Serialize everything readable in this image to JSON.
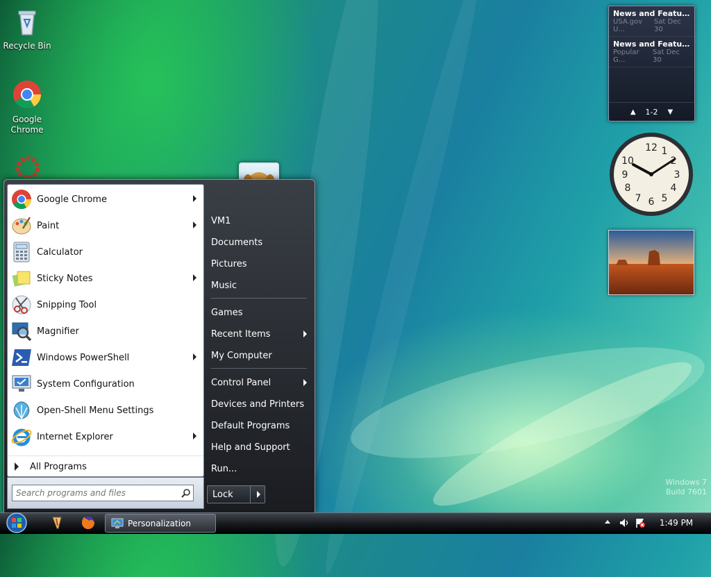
{
  "desktop": {
    "icons": [
      {
        "label": "Recycle Bin"
      },
      {
        "label": "Google Chrome"
      }
    ],
    "watermark": {
      "line1": "Windows 7",
      "line2": "Build 7601"
    }
  },
  "gadgets": {
    "news": {
      "items": [
        {
          "title": "News and Features f...",
          "source": "USA.gov U...",
          "date": "Sat Dec 30"
        },
        {
          "title": "News and Feature...",
          "source": "Popular G...",
          "date": "Sat Dec 30"
        }
      ],
      "page": "1-2"
    }
  },
  "start_menu": {
    "programs": [
      {
        "label": "Google Chrome",
        "has_submenu": true
      },
      {
        "label": "Paint",
        "has_submenu": true
      },
      {
        "label": "Calculator",
        "has_submenu": false
      },
      {
        "label": "Sticky Notes",
        "has_submenu": true
      },
      {
        "label": "Snipping Tool",
        "has_submenu": false
      },
      {
        "label": "Magnifier",
        "has_submenu": false
      },
      {
        "label": "Windows PowerShell",
        "has_submenu": true
      },
      {
        "label": "System Configuration",
        "has_submenu": false
      },
      {
        "label": "Open-Shell Menu Settings",
        "has_submenu": false
      },
      {
        "label": "Internet Explorer",
        "has_submenu": true
      }
    ],
    "all_programs": "All Programs",
    "search_placeholder": "Search programs and files",
    "right_items": [
      {
        "label": "VM1"
      },
      {
        "label": "Documents"
      },
      {
        "label": "Pictures"
      },
      {
        "label": "Music"
      },
      {
        "label": "Games"
      },
      {
        "label": "Recent Items"
      },
      {
        "label": "My Computer"
      },
      {
        "label": "Control Panel"
      },
      {
        "label": "Devices and Printers"
      },
      {
        "label": "Default Programs"
      },
      {
        "label": "Help and Support"
      },
      {
        "label": "Run..."
      }
    ],
    "lock_label": "Lock"
  },
  "taskbar": {
    "active_window": "Personalization",
    "time": "1:49 PM"
  }
}
